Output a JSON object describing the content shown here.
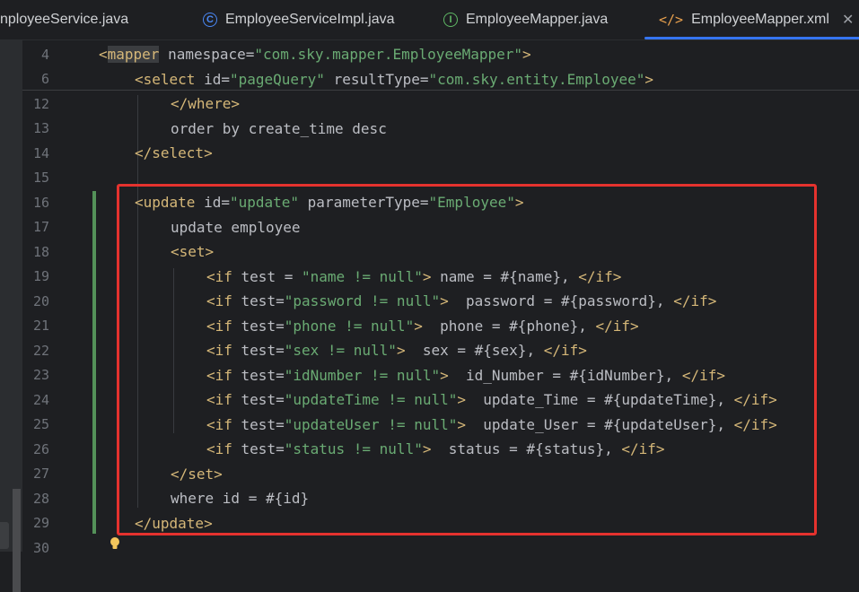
{
  "tabs": [
    {
      "label": "nployeeService.java",
      "icon": "interface-icon",
      "active": false
    },
    {
      "label": "EmployeeServiceImpl.java",
      "icon": "class-icon",
      "active": false
    },
    {
      "label": "EmployeeMapper.java",
      "icon": "interface-icon",
      "active": false
    },
    {
      "label": "EmployeeMapper.xml",
      "icon": "xml-icon",
      "active": true
    }
  ],
  "tab_icons": {
    "class": "C",
    "interface": "I",
    "xml": "</>",
    "close": "✕"
  },
  "lines": [
    {
      "n": "4",
      "tokens": [
        [
          "tag",
          "<"
        ],
        [
          "tag",
          "mapper"
        ],
        [
          "attr",
          " namespace="
        ],
        [
          "str",
          "\"com.sky.mapper.EmployeeMapper\""
        ],
        [
          "tag",
          ">"
        ]
      ],
      "indent": 0
    },
    {
      "n": "6",
      "tokens": [
        [
          "tag",
          "<select"
        ],
        [
          "attr",
          " id="
        ],
        [
          "str",
          "\"pageQuery\""
        ],
        [
          "attr",
          " resultType="
        ],
        [
          "str",
          "\"com.sky.entity.Employee\""
        ],
        [
          "tag",
          ">"
        ]
      ],
      "indent": 1
    },
    {
      "n": "12",
      "tokens": [
        [
          "tag",
          "</where>"
        ]
      ],
      "indent": 2
    },
    {
      "n": "13",
      "tokens": [
        [
          "txt",
          "order by create_time desc"
        ]
      ],
      "indent": 2
    },
    {
      "n": "14",
      "tokens": [
        [
          "tag",
          "</select>"
        ]
      ],
      "indent": 1
    },
    {
      "n": "15",
      "tokens": [],
      "indent": 0
    },
    {
      "n": "16",
      "tokens": [
        [
          "tag",
          "<update"
        ],
        [
          "attr",
          " id="
        ],
        [
          "str",
          "\"update\""
        ],
        [
          "attr",
          " parameterType="
        ],
        [
          "str",
          "\"Employee\""
        ],
        [
          "tag",
          ">"
        ]
      ],
      "indent": 1
    },
    {
      "n": "17",
      "tokens": [
        [
          "txt",
          "update employee"
        ]
      ],
      "indent": 2
    },
    {
      "n": "18",
      "tokens": [
        [
          "tag",
          "<set>"
        ]
      ],
      "indent": 2
    },
    {
      "n": "19",
      "tokens": [
        [
          "tag",
          "<if"
        ],
        [
          "attr",
          " test = "
        ],
        [
          "str",
          "\"name != null\""
        ],
        [
          "tag",
          ">"
        ],
        [
          "txt",
          " name = #{name}, "
        ],
        [
          "tag",
          "</if>"
        ]
      ],
      "indent": 3
    },
    {
      "n": "20",
      "tokens": [
        [
          "tag",
          "<if"
        ],
        [
          "attr",
          " test="
        ],
        [
          "str",
          "\"password != null\""
        ],
        [
          "tag",
          ">"
        ],
        [
          "txt",
          "  password = #{password}, "
        ],
        [
          "tag",
          "</if>"
        ]
      ],
      "indent": 3
    },
    {
      "n": "21",
      "tokens": [
        [
          "tag",
          "<if"
        ],
        [
          "attr",
          " test="
        ],
        [
          "str",
          "\"phone != null\""
        ],
        [
          "tag",
          ">"
        ],
        [
          "txt",
          "  phone = #{phone}, "
        ],
        [
          "tag",
          "</if>"
        ]
      ],
      "indent": 3
    },
    {
      "n": "22",
      "tokens": [
        [
          "tag",
          "<if"
        ],
        [
          "attr",
          " test="
        ],
        [
          "str",
          "\"sex != null\""
        ],
        [
          "tag",
          ">"
        ],
        [
          "txt",
          "  sex = #{sex}, "
        ],
        [
          "tag",
          "</if>"
        ]
      ],
      "indent": 3
    },
    {
      "n": "23",
      "tokens": [
        [
          "tag",
          "<if"
        ],
        [
          "attr",
          " test="
        ],
        [
          "str",
          "\"idNumber != null\""
        ],
        [
          "tag",
          ">"
        ],
        [
          "txt",
          "  id_Number = #{idNumber}, "
        ],
        [
          "tag",
          "</if>"
        ]
      ],
      "indent": 3
    },
    {
      "n": "24",
      "tokens": [
        [
          "tag",
          "<if"
        ],
        [
          "attr",
          " test="
        ],
        [
          "str",
          "\"updateTime != null\""
        ],
        [
          "tag",
          ">"
        ],
        [
          "txt",
          "  update_Time = #{updateTime}, "
        ],
        [
          "tag",
          "</if>"
        ]
      ],
      "indent": 3
    },
    {
      "n": "25",
      "tokens": [
        [
          "tag",
          "<if"
        ],
        [
          "attr",
          " test="
        ],
        [
          "str",
          "\"updateUser != null\""
        ],
        [
          "tag",
          ">"
        ],
        [
          "txt",
          "  update_User = #{updateUser}, "
        ],
        [
          "tag",
          "</if>"
        ]
      ],
      "indent": 3
    },
    {
      "n": "26",
      "tokens": [
        [
          "tag",
          "<if"
        ],
        [
          "attr",
          " test="
        ],
        [
          "str",
          "\"status != null\""
        ],
        [
          "tag",
          ">"
        ],
        [
          "txt",
          "  status = #{status}, "
        ],
        [
          "tag",
          "</if>"
        ]
      ],
      "indent": 3
    },
    {
      "n": "27",
      "tokens": [
        [
          "tag",
          "</set>"
        ]
      ],
      "indent": 2
    },
    {
      "n": "28",
      "tokens": [
        [
          "txt",
          "where id = #{id}"
        ]
      ],
      "indent": 2
    },
    {
      "n": "29",
      "tokens": [
        [
          "tag",
          "</update>"
        ]
      ],
      "indent": 1
    },
    {
      "n": "30",
      "tokens": [],
      "indent": 0
    }
  ],
  "colors": {
    "tag": "#d5b778",
    "string": "#6aab73",
    "text": "#bcbec4",
    "highlight_box": "#e5322e",
    "active_tab_underline": "#3574f0",
    "vcs_modified": "#549159"
  }
}
